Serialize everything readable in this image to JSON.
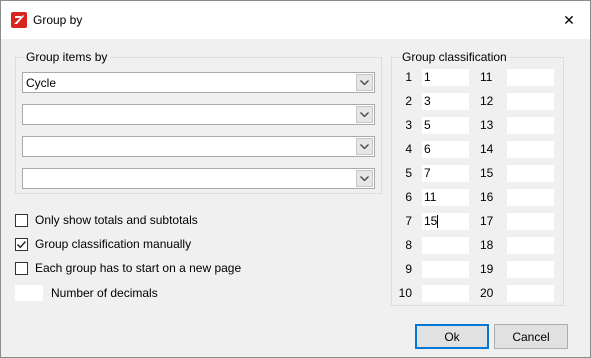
{
  "window": {
    "title": "Group by",
    "close_symbol": "✕"
  },
  "group_items": {
    "label": "Group items by",
    "combos": [
      {
        "value": "Cycle"
      },
      {
        "value": ""
      },
      {
        "value": ""
      },
      {
        "value": ""
      }
    ]
  },
  "options": {
    "totals_only": {
      "label": "Only show totals and subtotals",
      "checked": false
    },
    "manual_classification": {
      "label": "Group classification manually",
      "checked": true
    },
    "new_page": {
      "label": "Each group has to start on a new page",
      "checked": false
    },
    "decimals": {
      "label": "Number of decimals",
      "value": ""
    }
  },
  "classification": {
    "label": "Group classification",
    "left": [
      {
        "num": "1",
        "value": "1"
      },
      {
        "num": "2",
        "value": "3"
      },
      {
        "num": "3",
        "value": "5"
      },
      {
        "num": "4",
        "value": "6"
      },
      {
        "num": "5",
        "value": "7"
      },
      {
        "num": "6",
        "value": "11"
      },
      {
        "num": "7",
        "value": "15"
      },
      {
        "num": "8",
        "value": ""
      },
      {
        "num": "9",
        "value": ""
      },
      {
        "num": "10",
        "value": ""
      }
    ],
    "right": [
      {
        "num": "11",
        "value": ""
      },
      {
        "num": "12",
        "value": ""
      },
      {
        "num": "13",
        "value": ""
      },
      {
        "num": "14",
        "value": ""
      },
      {
        "num": "15",
        "value": ""
      },
      {
        "num": "16",
        "value": ""
      },
      {
        "num": "17",
        "value": ""
      },
      {
        "num": "18",
        "value": ""
      },
      {
        "num": "19",
        "value": ""
      },
      {
        "num": "20",
        "value": ""
      }
    ]
  },
  "buttons": {
    "ok": "Ok",
    "cancel": "Cancel"
  },
  "colors": {
    "accent": "#0078d7",
    "app_icon": "#d9261c"
  }
}
